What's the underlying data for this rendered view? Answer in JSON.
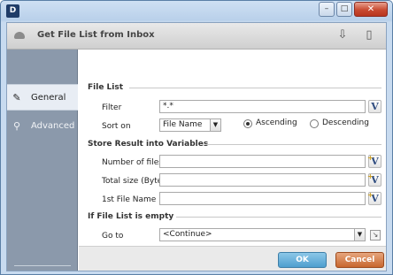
{
  "titlebar": {
    "app_icon": "D",
    "min": "–",
    "max": "□",
    "close": "✕"
  },
  "header": {
    "title": "Get File List from Inbox",
    "tool_icons": [
      "save-add-icon",
      "notes-icon"
    ]
  },
  "sidebar": {
    "items": [
      {
        "label": "General",
        "icon": "pencil-icon"
      },
      {
        "label": "Advanced",
        "icon": "magnifier-icon"
      }
    ]
  },
  "sections": {
    "file_list": "File List",
    "store_result": "Store Result  into Variables",
    "if_empty": "If File List is empty"
  },
  "fields": {
    "filter_label": "Filter",
    "filter_value": "*.*",
    "sort_on_label": "Sort on",
    "sort_on_value": "File Name",
    "sort_ascending": "Ascending",
    "sort_descending": "Descending",
    "num_files_label": "Number of files",
    "num_files_value": "",
    "total_size_label": "Total size (Bytes)",
    "total_size_value": "",
    "first_file_label": "1st File Name",
    "first_file_value": "",
    "goto_label": "Go to",
    "goto_value": "<Continue>"
  },
  "glyphs": {
    "var": "V",
    "arrow_down": "▼",
    "goto_nav": "↘"
  },
  "footer": {
    "ok": "OK",
    "cancel": "Cancel"
  }
}
